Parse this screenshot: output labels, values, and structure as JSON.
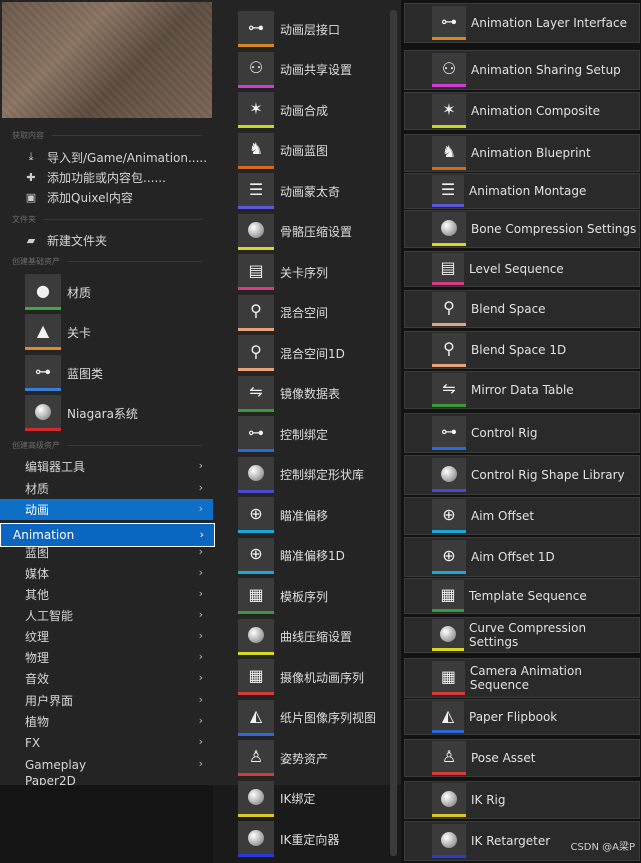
{
  "left": {
    "sections": {
      "get_content": "获取内容",
      "folder": "文件夹",
      "basic_assets": "创建基础资产",
      "advanced_assets": "创建高级资产"
    },
    "actions": [
      {
        "label": "导入到/Game/Animation.....",
        "icon": "import-icon"
      },
      {
        "label": "添加功能或内容包......",
        "icon": "add-feature-icon"
      },
      {
        "label": "添加Quixel内容",
        "icon": "quixel-icon"
      }
    ],
    "new_folder": "新建文件夹",
    "basic": [
      {
        "label": "材质",
        "icon": "material-icon",
        "bar": "#3aaa3a"
      },
      {
        "label": "关卡",
        "icon": "level-icon",
        "bar": "#e08a2a"
      },
      {
        "label": "蓝图类",
        "icon": "blueprint-icon",
        "bar": "#3a7ed8"
      },
      {
        "label": "Niagara系统",
        "icon": "niagara-icon",
        "bar": "#d22a2a"
      }
    ],
    "categories": [
      "编辑器工具",
      "材质",
      "动画",
      "Animation",
      "蓝图",
      "媒体",
      "其他",
      "人工智能",
      "纹理",
      "物理",
      "音效",
      "用户界面",
      "植物",
      "FX",
      "Gameplay",
      "Paper2D"
    ]
  },
  "middle": [
    {
      "label": "动画层接口",
      "icon": "interface-icon",
      "bar": "#d4891f"
    },
    {
      "label": "动画共享设置",
      "icon": "sharing-icon",
      "bar": "#d43ad4"
    },
    {
      "label": "动画合成",
      "icon": "composite-icon",
      "bar": "#c8d818"
    },
    {
      "label": "动画蓝图",
      "icon": "anim-blueprint-icon",
      "bar": "#d46a1a"
    },
    {
      "label": "动画蒙太奇",
      "icon": "montage-icon",
      "bar": "#5a5ad8"
    },
    {
      "label": "骨骼压缩设置",
      "icon": "compression-icon",
      "bar": "#d8d820"
    },
    {
      "label": "关卡序列",
      "icon": "sequence-icon",
      "bar": "#d83a8a"
    },
    {
      "label": "混合空间",
      "icon": "blendspace-icon",
      "bar": "#e8a27a"
    },
    {
      "label": "混合空间1D",
      "icon": "blendspace1d-icon",
      "bar": "#e8a27a"
    },
    {
      "label": "镜像数据表",
      "icon": "mirror-icon",
      "bar": "#3a9a3a"
    },
    {
      "label": "控制绑定",
      "icon": "control-rig-icon",
      "bar": "#2a6ad8"
    },
    {
      "label": "控制绑定形状库",
      "icon": "shape-library-icon",
      "bar": "#4a4ad0"
    },
    {
      "label": "瞄准偏移",
      "icon": "aim-icon",
      "bar": "#1aa8d8"
    },
    {
      "label": "瞄准偏移1D",
      "icon": "aim1d-icon",
      "bar": "#1aa8d8"
    },
    {
      "label": "模板序列",
      "icon": "template-icon",
      "bar": "#3a9a3a"
    },
    {
      "label": "曲线压缩设置",
      "icon": "curve-icon",
      "bar": "#d8d820"
    },
    {
      "label": "摄像机动画序列",
      "icon": "camera-icon",
      "bar": "#d83a3a"
    },
    {
      "label": "纸片图像序列视图",
      "icon": "flipbook-icon",
      "bar": "#2a6ad8"
    },
    {
      "label": "姿势资产",
      "icon": "pose-icon",
      "bar": "#d83a3a"
    },
    {
      "label": "IK绑定",
      "icon": "ik-rig-icon",
      "bar": "#d8c820"
    },
    {
      "label": "IK重定向器",
      "icon": "ik-retarget-icon",
      "bar": "#2a3ad8"
    }
  ],
  "right": [
    {
      "label": "Animation Layer Interface",
      "icon": "interface-icon",
      "bar": "#d4891f"
    },
    {
      "label": "Animation Sharing Setup",
      "icon": "sharing-icon",
      "bar": "#d43ad4"
    },
    {
      "label": "Animation Composite",
      "icon": "composite-icon",
      "bar": "#c8d818"
    },
    {
      "label": "Animation Blueprint",
      "icon": "anim-blueprint-icon",
      "bar": "#d46a1a"
    },
    {
      "label": "Animation Montage",
      "icon": "montage-icon",
      "bar": "#5a5ad8"
    },
    {
      "label": "Bone Compression Settings",
      "icon": "compression-icon",
      "bar": "#d8d820"
    },
    {
      "label": "Level Sequence",
      "icon": "sequence-icon",
      "bar": "#d83a8a"
    },
    {
      "label": "Blend Space",
      "icon": "blendspace-icon",
      "bar": "#e8a27a"
    },
    {
      "label": "Blend Space 1D",
      "icon": "blendspace1d-icon",
      "bar": "#e8a27a"
    },
    {
      "label": "Mirror Data Table",
      "icon": "mirror-icon",
      "bar": "#3a9a3a"
    },
    {
      "label": "Control Rig",
      "icon": "control-rig-icon",
      "bar": "#2a6ad8"
    },
    {
      "label": "Control Rig Shape Library",
      "icon": "shape-library-icon",
      "bar": "#4a4ad0"
    },
    {
      "label": "Aim Offset",
      "icon": "aim-icon",
      "bar": "#1aa8d8"
    },
    {
      "label": "Aim Offset 1D",
      "icon": "aim1d-icon",
      "bar": "#1aa8d8"
    },
    {
      "label": "Template Sequence",
      "icon": "template-icon",
      "bar": "#3a9a3a"
    },
    {
      "label": "Curve Compression Settings",
      "icon": "curve-icon",
      "bar": "#d8d820"
    },
    {
      "label": "Camera Animation Sequence",
      "icon": "camera-icon",
      "bar": "#d83a3a"
    },
    {
      "label": "Paper Flipbook",
      "icon": "flipbook-icon",
      "bar": "#2a6ad8"
    },
    {
      "label": "Pose Asset",
      "icon": "pose-icon",
      "bar": "#d83a3a"
    },
    {
      "label": "IK Rig",
      "icon": "ik-rig-icon",
      "bar": "#d8c820"
    },
    {
      "label": "IK Retargeter",
      "icon": "ik-retarget-icon",
      "bar": "#2a3ad8"
    }
  ],
  "watermark": "CSDN @A梁P"
}
